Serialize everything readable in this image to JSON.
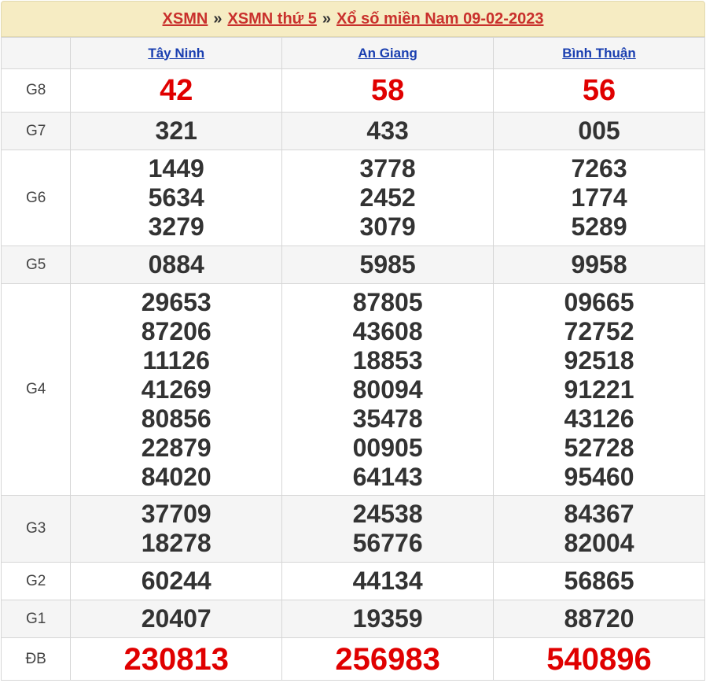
{
  "breadcrumb": {
    "link1": "XSMN",
    "sep": "»",
    "link2": "XSMN thứ 5",
    "link3": "Xổ số miền Nam 09-02-2023"
  },
  "provinces": [
    "Tây Ninh",
    "An Giang",
    "Bình Thuận"
  ],
  "rows": {
    "g8": {
      "label": "G8",
      "values": [
        [
          "42"
        ],
        [
          "58"
        ],
        [
          "56"
        ]
      ]
    },
    "g7": {
      "label": "G7",
      "values": [
        [
          "321"
        ],
        [
          "433"
        ],
        [
          "005"
        ]
      ]
    },
    "g6": {
      "label": "G6",
      "values": [
        [
          "1449",
          "5634",
          "3279"
        ],
        [
          "3778",
          "2452",
          "3079"
        ],
        [
          "7263",
          "1774",
          "5289"
        ]
      ]
    },
    "g5": {
      "label": "G5",
      "values": [
        [
          "0884"
        ],
        [
          "5985"
        ],
        [
          "9958"
        ]
      ]
    },
    "g4": {
      "label": "G4",
      "values": [
        [
          "29653",
          "87206",
          "11126",
          "41269",
          "80856",
          "22879",
          "84020"
        ],
        [
          "87805",
          "43608",
          "18853",
          "80094",
          "35478",
          "00905",
          "64143"
        ],
        [
          "09665",
          "72752",
          "92518",
          "91221",
          "43126",
          "52728",
          "95460"
        ]
      ]
    },
    "g3": {
      "label": "G3",
      "values": [
        [
          "37709",
          "18278"
        ],
        [
          "24538",
          "56776"
        ],
        [
          "84367",
          "82004"
        ]
      ]
    },
    "g2": {
      "label": "G2",
      "values": [
        [
          "60244"
        ],
        [
          "44134"
        ],
        [
          "56865"
        ]
      ]
    },
    "g1": {
      "label": "G1",
      "values": [
        [
          "20407"
        ],
        [
          "19359"
        ],
        [
          "88720"
        ]
      ]
    },
    "db": {
      "label": "ĐB",
      "values": [
        [
          "230813"
        ],
        [
          "256983"
        ],
        [
          "540896"
        ]
      ]
    }
  },
  "colors": {
    "accent_red": "#e00000",
    "link_blue": "#1a3fb0",
    "header_bg": "#f6ecc3",
    "breadcrumb_link": "#c9302c"
  }
}
